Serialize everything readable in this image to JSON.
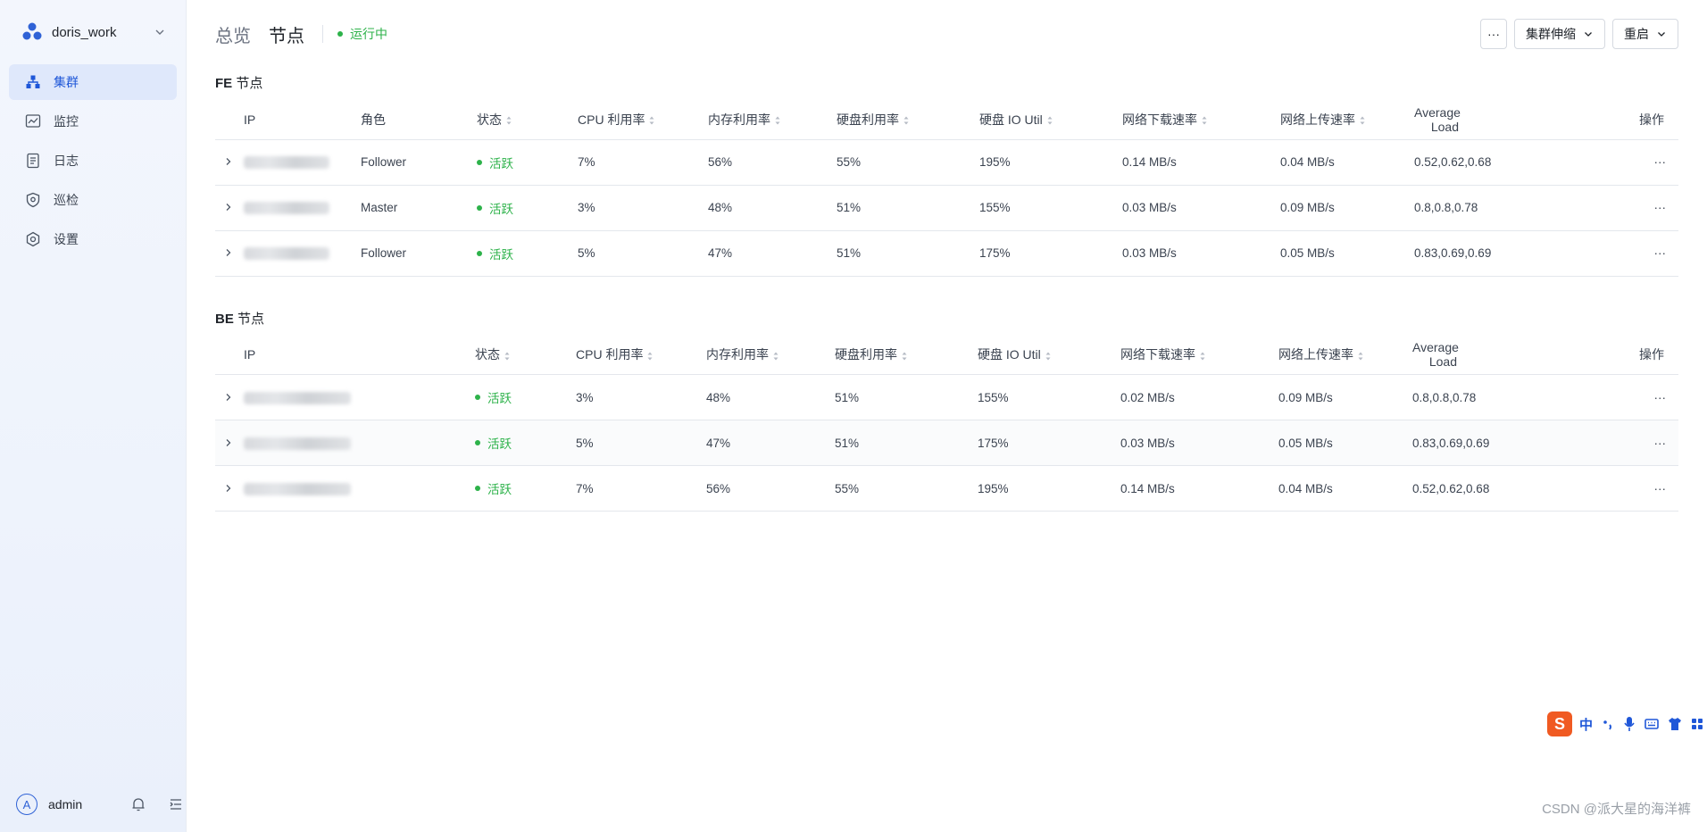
{
  "sidebar": {
    "workspace": "doris_work",
    "items": [
      {
        "label": "集群",
        "icon": "cluster-icon",
        "active": true
      },
      {
        "label": "监控",
        "icon": "chart-icon",
        "active": false
      },
      {
        "label": "日志",
        "icon": "log-icon",
        "active": false
      },
      {
        "label": "巡检",
        "icon": "shield-icon",
        "active": false
      },
      {
        "label": "设置",
        "icon": "gear-icon",
        "active": false
      }
    ],
    "user": {
      "avatar_letter": "A",
      "name": "admin"
    }
  },
  "header": {
    "tabs": [
      {
        "label": "总览",
        "active": false
      },
      {
        "label": "节点",
        "active": true
      }
    ],
    "status": "运行中",
    "more_label": "···",
    "scale_label": "集群伸缩",
    "restart_label": "重启"
  },
  "fe": {
    "title_prefix": "FE",
    "title_suffix": "节点",
    "columns": {
      "ip": "IP",
      "role": "角色",
      "state": "状态",
      "cpu": "CPU 利用率",
      "mem": "内存利用率",
      "disk": "硬盘利用率",
      "io": "硬盘 IO Util",
      "down": "网络下载速率",
      "up": "网络上传速率",
      "load": "Average Load",
      "ops": "操作"
    },
    "rows": [
      {
        "role": "Follower",
        "state": "活跃",
        "cpu": "7%",
        "mem": "56%",
        "disk": "55%",
        "io": "195%",
        "down": "0.14 MB/s",
        "up": "0.04 MB/s",
        "load": "0.52,0.62,0.68",
        "ops": "···"
      },
      {
        "role": "Master",
        "state": "活跃",
        "cpu": "3%",
        "mem": "48%",
        "disk": "51%",
        "io": "155%",
        "down": "0.03 MB/s",
        "up": "0.09 MB/s",
        "load": "0.8,0.8,0.78",
        "ops": "···"
      },
      {
        "role": "Follower",
        "state": "活跃",
        "cpu": "5%",
        "mem": "47%",
        "disk": "51%",
        "io": "175%",
        "down": "0.03 MB/s",
        "up": "0.05 MB/s",
        "load": "0.83,0.69,0.69",
        "ops": "···"
      }
    ]
  },
  "be": {
    "title_prefix": "BE",
    "title_suffix": "节点",
    "columns": {
      "ip": "IP",
      "state": "状态",
      "cpu": "CPU 利用率",
      "mem": "内存利用率",
      "disk": "硬盘利用率",
      "io": "硬盘 IO Util",
      "down": "网络下载速率",
      "up": "网络上传速率",
      "load": "Average Load",
      "ops": "操作"
    },
    "rows": [
      {
        "state": "活跃",
        "cpu": "3%",
        "mem": "48%",
        "disk": "51%",
        "io": "155%",
        "down": "0.02 MB/s",
        "up": "0.09 MB/s",
        "load": "0.8,0.8,0.78",
        "ops": "···"
      },
      {
        "state": "活跃",
        "cpu": "5%",
        "mem": "47%",
        "disk": "51%",
        "io": "175%",
        "down": "0.03 MB/s",
        "up": "0.05 MB/s",
        "load": "0.83,0.69,0.69",
        "ops": "···"
      },
      {
        "state": "活跃",
        "cpu": "7%",
        "mem": "56%",
        "disk": "55%",
        "io": "195%",
        "down": "0.14 MB/s",
        "up": "0.04 MB/s",
        "load": "0.52,0.62,0.68",
        "ops": "···"
      }
    ]
  },
  "ime": {
    "logo": "S",
    "lang": "中"
  },
  "watermark": "CSDN @派大星的海洋裤"
}
